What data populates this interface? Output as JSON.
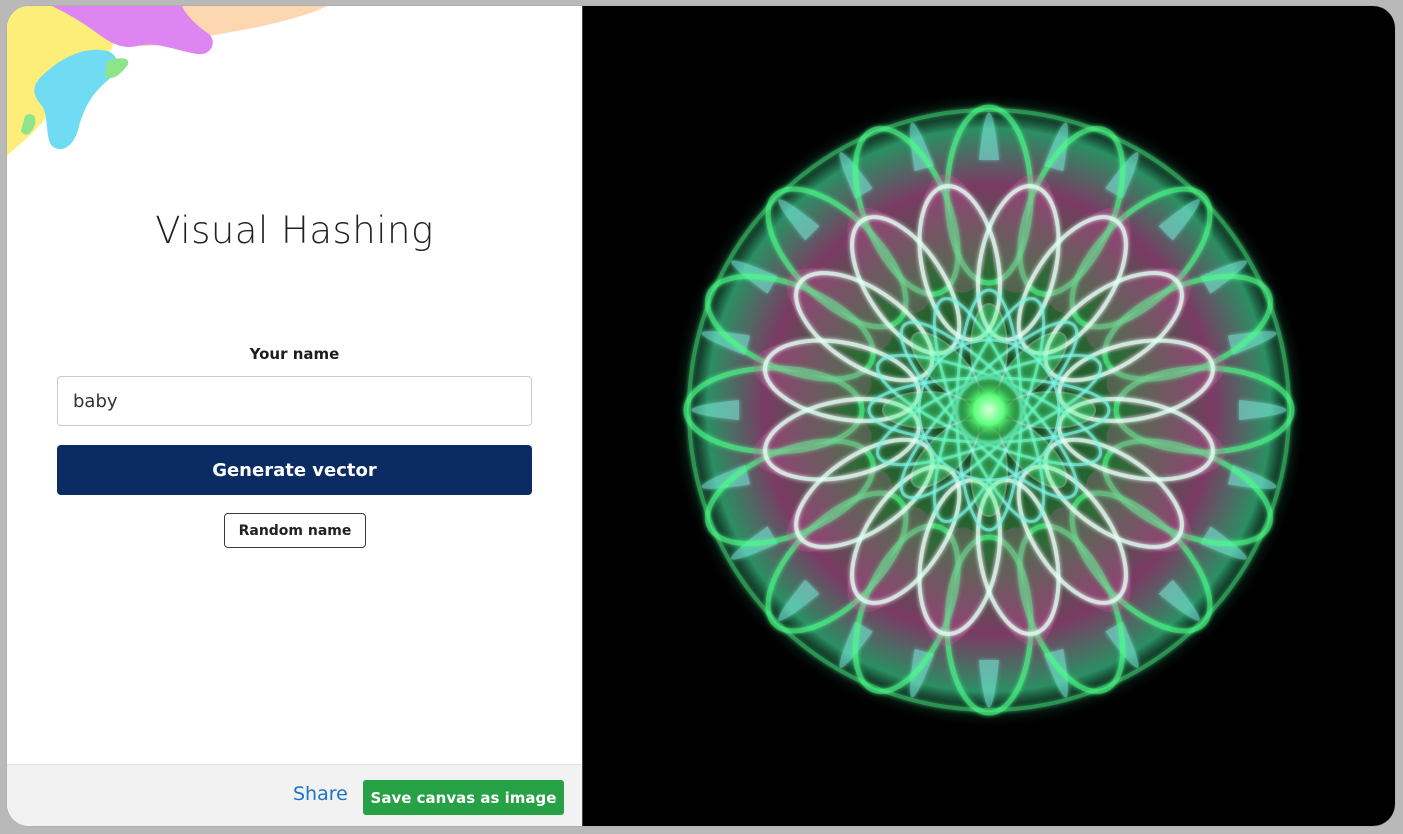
{
  "app": {
    "title": "Visual Hashing"
  },
  "form": {
    "name_label": "Your name",
    "name_value": "baby",
    "generate_label": "Generate vector",
    "random_label": "Random name"
  },
  "footer": {
    "share_label": "Share",
    "save_label": "Save canvas as image"
  },
  "colors": {
    "primary_button": "#0a2c63",
    "save_button": "#27a145",
    "link": "#1a73c8",
    "canvas_background": "#000000",
    "mandala_green": "#4dff8a",
    "mandala_cyan": "#7ff5e6",
    "mandala_pink": "#d25fa8"
  }
}
